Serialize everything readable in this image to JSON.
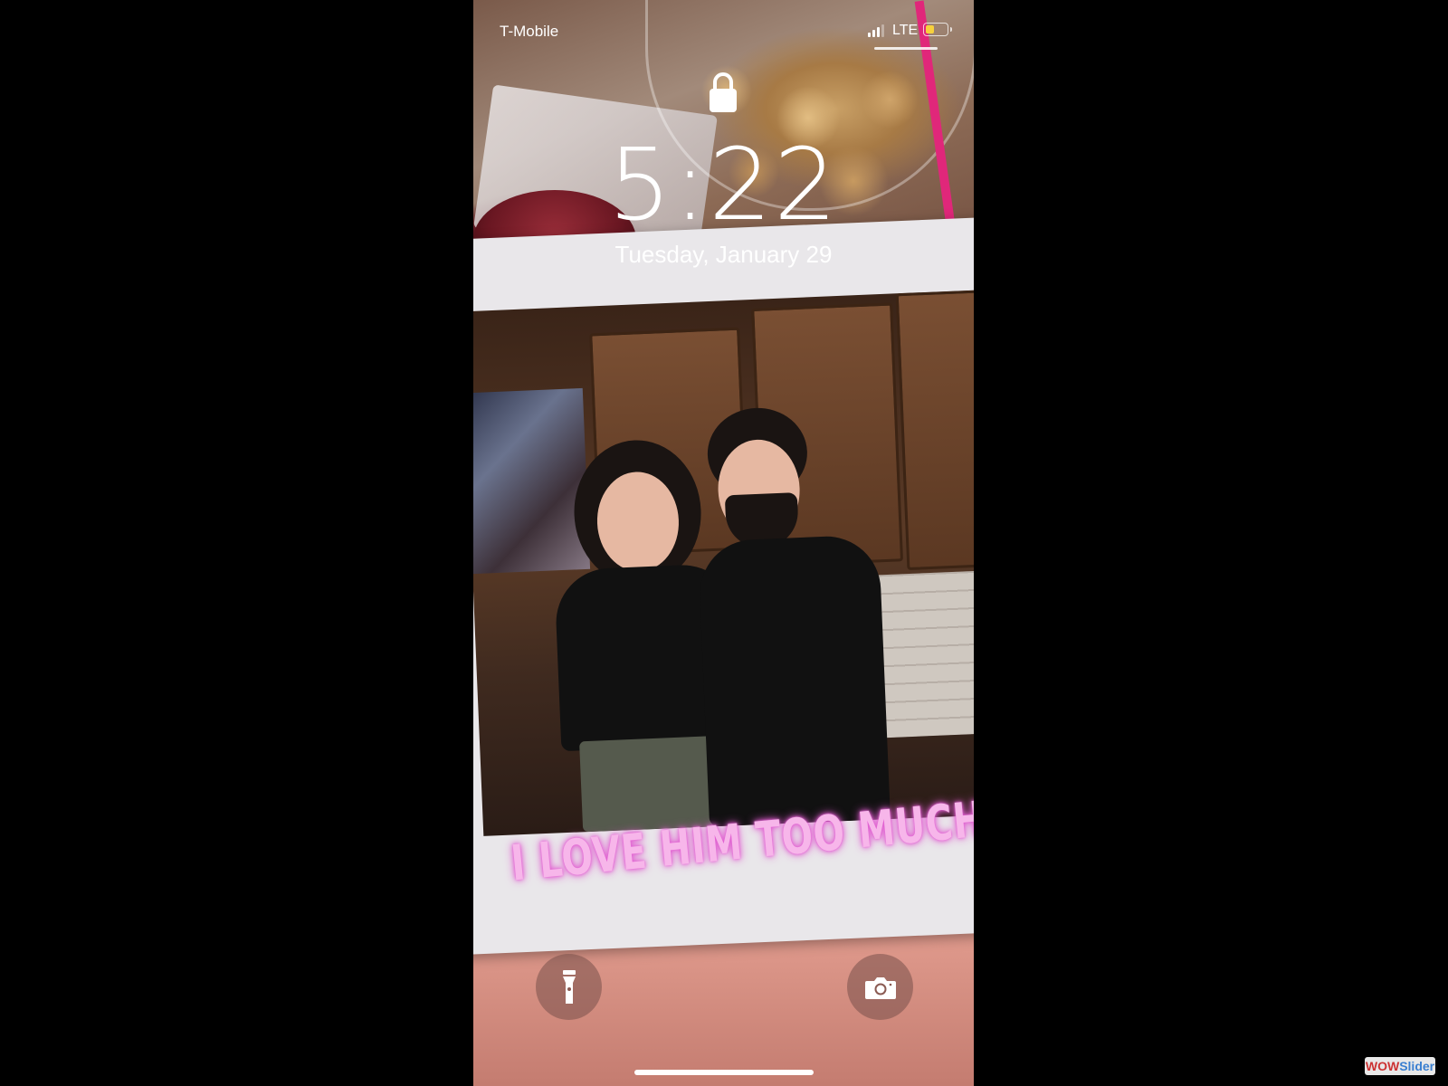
{
  "status_bar": {
    "carrier": "T-Mobile",
    "network": "LTE",
    "signal_bars": 3,
    "battery_level": 0.45,
    "battery_color": "#f7d13c"
  },
  "lock_screen": {
    "lock_icon": "lock-icon",
    "time": "5:22",
    "date": "Tuesday, January 29"
  },
  "wallpaper": {
    "caption": "I LOVE HIM TOO MUCH"
  },
  "quick_actions": {
    "flashlight_icon": "flashlight-icon",
    "camera_icon": "camera-icon"
  },
  "watermark": {
    "part1": "WOW",
    "part2": "Slider"
  }
}
